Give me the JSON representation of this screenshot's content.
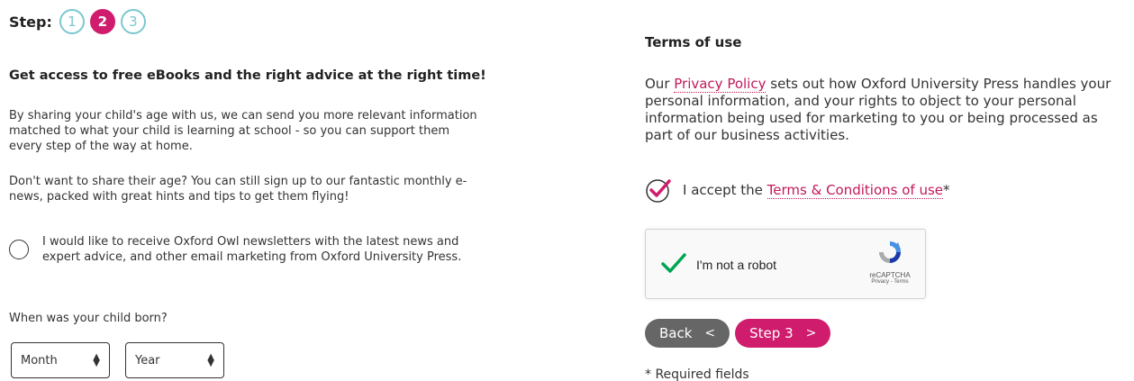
{
  "progress": {
    "label": "Step:",
    "steps": [
      "1",
      "2",
      "3"
    ],
    "current_step": 2
  },
  "intro": {
    "headline": "Get access to free eBooks and the right advice at the right time!",
    "paragraph1": "By sharing your child's age with us, we can send you more relevant information matched to what your child is learning at school - so you can support them every step of the way at home.",
    "paragraph2": "Don't want to share their age? You can still sign up to our fantastic monthly e-news, packed with great hints and tips to get them flying!"
  },
  "newsletter": {
    "label": "I would like to receive Oxford Owl newsletters with the latest news and expert advice, and other email marketing from Oxford University Press.",
    "checked": false
  },
  "birth": {
    "question": "When was your child born?",
    "month_value": "Month",
    "year_value": "Year"
  },
  "terms": {
    "title": "Terms of use",
    "privacy_prefix": "Our ",
    "privacy_link": "Privacy Policy",
    "privacy_suffix": " sets out how Oxford University Press handles your personal information, and your rights to object to your personal information being used for marketing to you or being processed as part of our business activities.",
    "accept_prefix": "I accept the ",
    "accept_link": "Terms & Conditions of use",
    "accept_required": "*",
    "accepted": true
  },
  "recaptcha": {
    "label": "I'm not a robot",
    "brand": "reCAPTCHA",
    "links": "Privacy - Terms",
    "verified": true
  },
  "buttons": {
    "back_label": "Back",
    "back_arrow": "<",
    "next_label": "Step 3",
    "next_arrow": ">"
  },
  "footer": {
    "required_note": "* Required fields"
  },
  "colors": {
    "accent": "#d01c6c",
    "step_outline": "#7cc7cf",
    "back_button": "#666666",
    "recaptcha_green": "#00a651"
  }
}
